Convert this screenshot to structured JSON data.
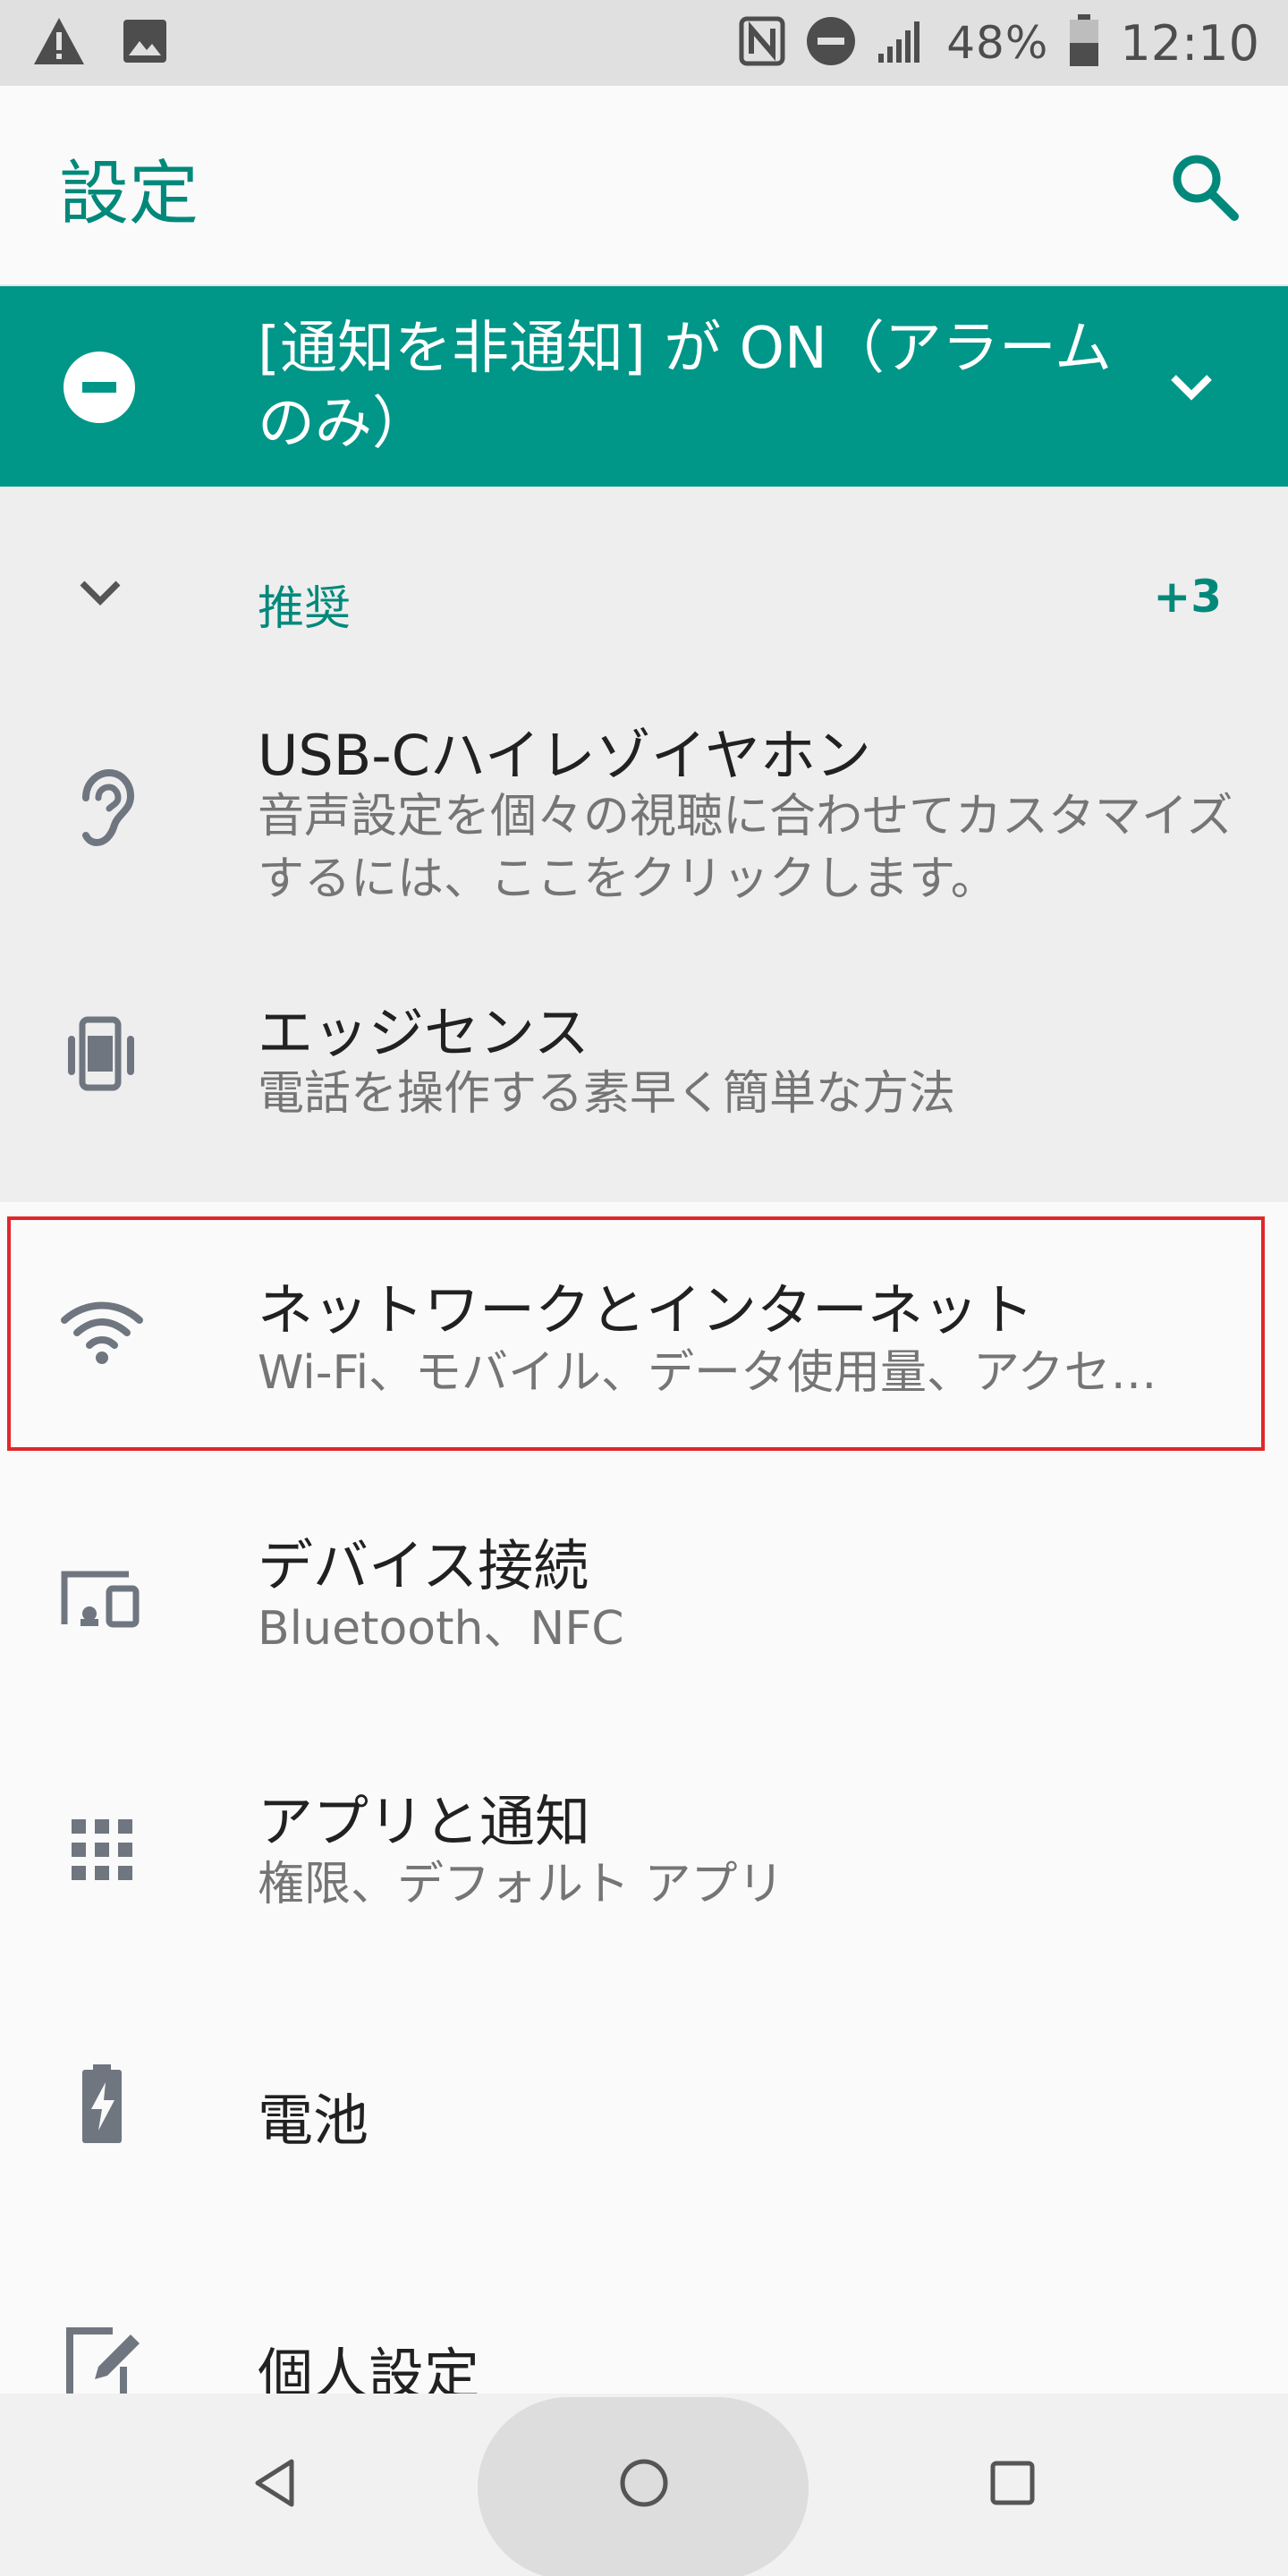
{
  "status_bar": {
    "battery": "48%",
    "time": "12:10",
    "icons": [
      "warning-icon",
      "image-icon",
      "nfc-icon",
      "dnd-icon",
      "signal-icon",
      "battery-icon"
    ]
  },
  "app_bar": {
    "title": "設定",
    "search_icon": "search-icon"
  },
  "dnd_banner": {
    "text": "[通知を非通知] が ON（アラームのみ）",
    "icon": "dnd-minus-icon",
    "expand_icon": "chevron-down-icon"
  },
  "suggestions": {
    "header": "推奨",
    "count": "+3",
    "items": [
      {
        "title": "USB-Cハイレゾイヤホン",
        "subtitle": "音声設定を個々の視聴に合わせてカスタマイズするには、ここをクリックします。",
        "icon": "ear-icon"
      },
      {
        "title": "エッジセンス",
        "subtitle": "電話を操作する素早く簡単な方法",
        "icon": "edge-sense-icon"
      }
    ]
  },
  "settings": [
    {
      "title": "ネットワークとインターネット",
      "subtitle": "Wi-Fi、モバイル、データ使用量、アクセ…",
      "icon": "wifi-icon",
      "highlighted": true
    },
    {
      "title": "デバイス接続",
      "subtitle": "Bluetooth、NFC",
      "icon": "devices-icon"
    },
    {
      "title": "アプリと通知",
      "subtitle": "権限、デフォルト アプリ",
      "icon": "apps-grid-icon"
    },
    {
      "title": "電池",
      "subtitle": "",
      "icon": "battery-charging-icon"
    },
    {
      "title": "個人設定",
      "subtitle": "",
      "icon": "personalize-icon"
    }
  ],
  "nav_bar": {
    "back": "back-icon",
    "home": "home-icon",
    "recents": "recents-icon"
  },
  "colors": {
    "accent": "#00897b",
    "banner": "#009688",
    "highlight": "#e2262a",
    "icon_gray": "#6f7680"
  }
}
